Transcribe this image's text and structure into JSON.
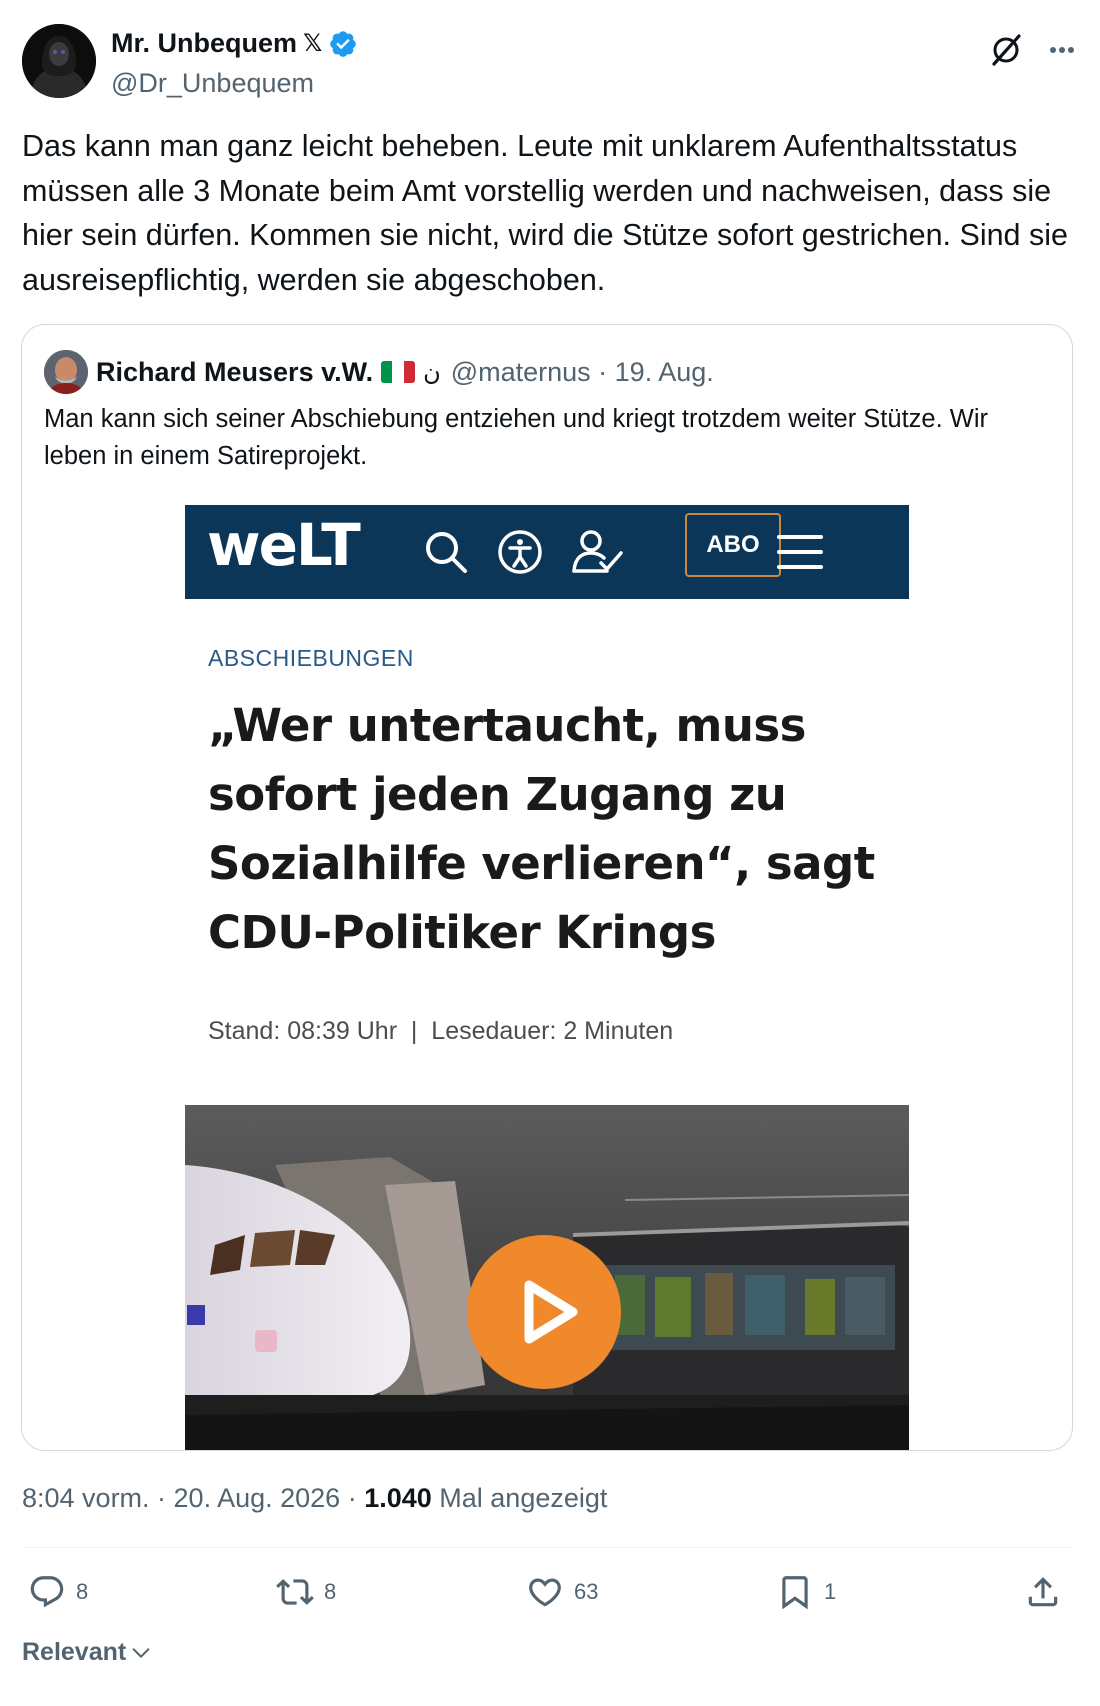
{
  "author": {
    "name": "Mr. Unbequem",
    "x_badge": "𝕏",
    "handle": "@Dr_Unbequem"
  },
  "tweet_text": "Das kann man ganz leicht beheben. Leute mit unklarem Aufenthaltsstatus müssen alle 3 Monate beim Amt vorstellig werden und nachweisen, dass sie hier sein dürfen. Kommen sie nicht, wird die Stütze sofort gestrichen. Sind sie ausreisepflichtig, werden sie abgeschoben.",
  "quote": {
    "name": "Richard Meusers v.W.",
    "symbol": "ن",
    "meta": "@maternus · 19. Aug.",
    "text": "Man kann sich seiner Abschiebung entziehen und kriegt trotzdem weiter Stütze. Wir leben in einem Satireprojekt."
  },
  "article": {
    "logo": "weLT",
    "abo_label": "ABO",
    "kicker": "ABSCHIEBUNGEN",
    "headline": "„Wer untertaucht, muss sofort jeden Zugang zu Sozialhilfe verlieren“, sagt CDU-Politiker Krings",
    "meta": "Stand: 08:39 Uhr  |  Lesedauer: 2 Minuten",
    "brand_color": "#0c3658"
  },
  "timestamp": "8:04 vorm. · 20. Aug. 2026 · ",
  "views_count": "1.040",
  "views_label": " Mal angezeigt",
  "actions": {
    "replies": "8",
    "reposts": "8",
    "likes": "63",
    "bookmarks": "1"
  },
  "sort_label": "Relevant",
  "colors": {
    "verified": "#1d9bf0",
    "secondary_text": "#536471",
    "play_button": "#f0892c"
  }
}
